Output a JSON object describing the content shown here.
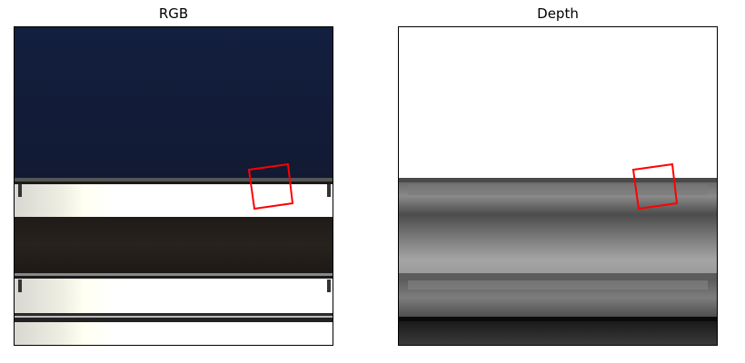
{
  "panels": [
    {
      "title": "RGB"
    },
    {
      "title": "Depth"
    }
  ],
  "annotation": {
    "shape": "rotated-square",
    "color": "#ff0000"
  },
  "colors": {
    "sky": "#131d38",
    "shelf_white": "#f4f4f2",
    "shelf_band_dark": "#241f1b",
    "depth_background": "#ffffff"
  }
}
